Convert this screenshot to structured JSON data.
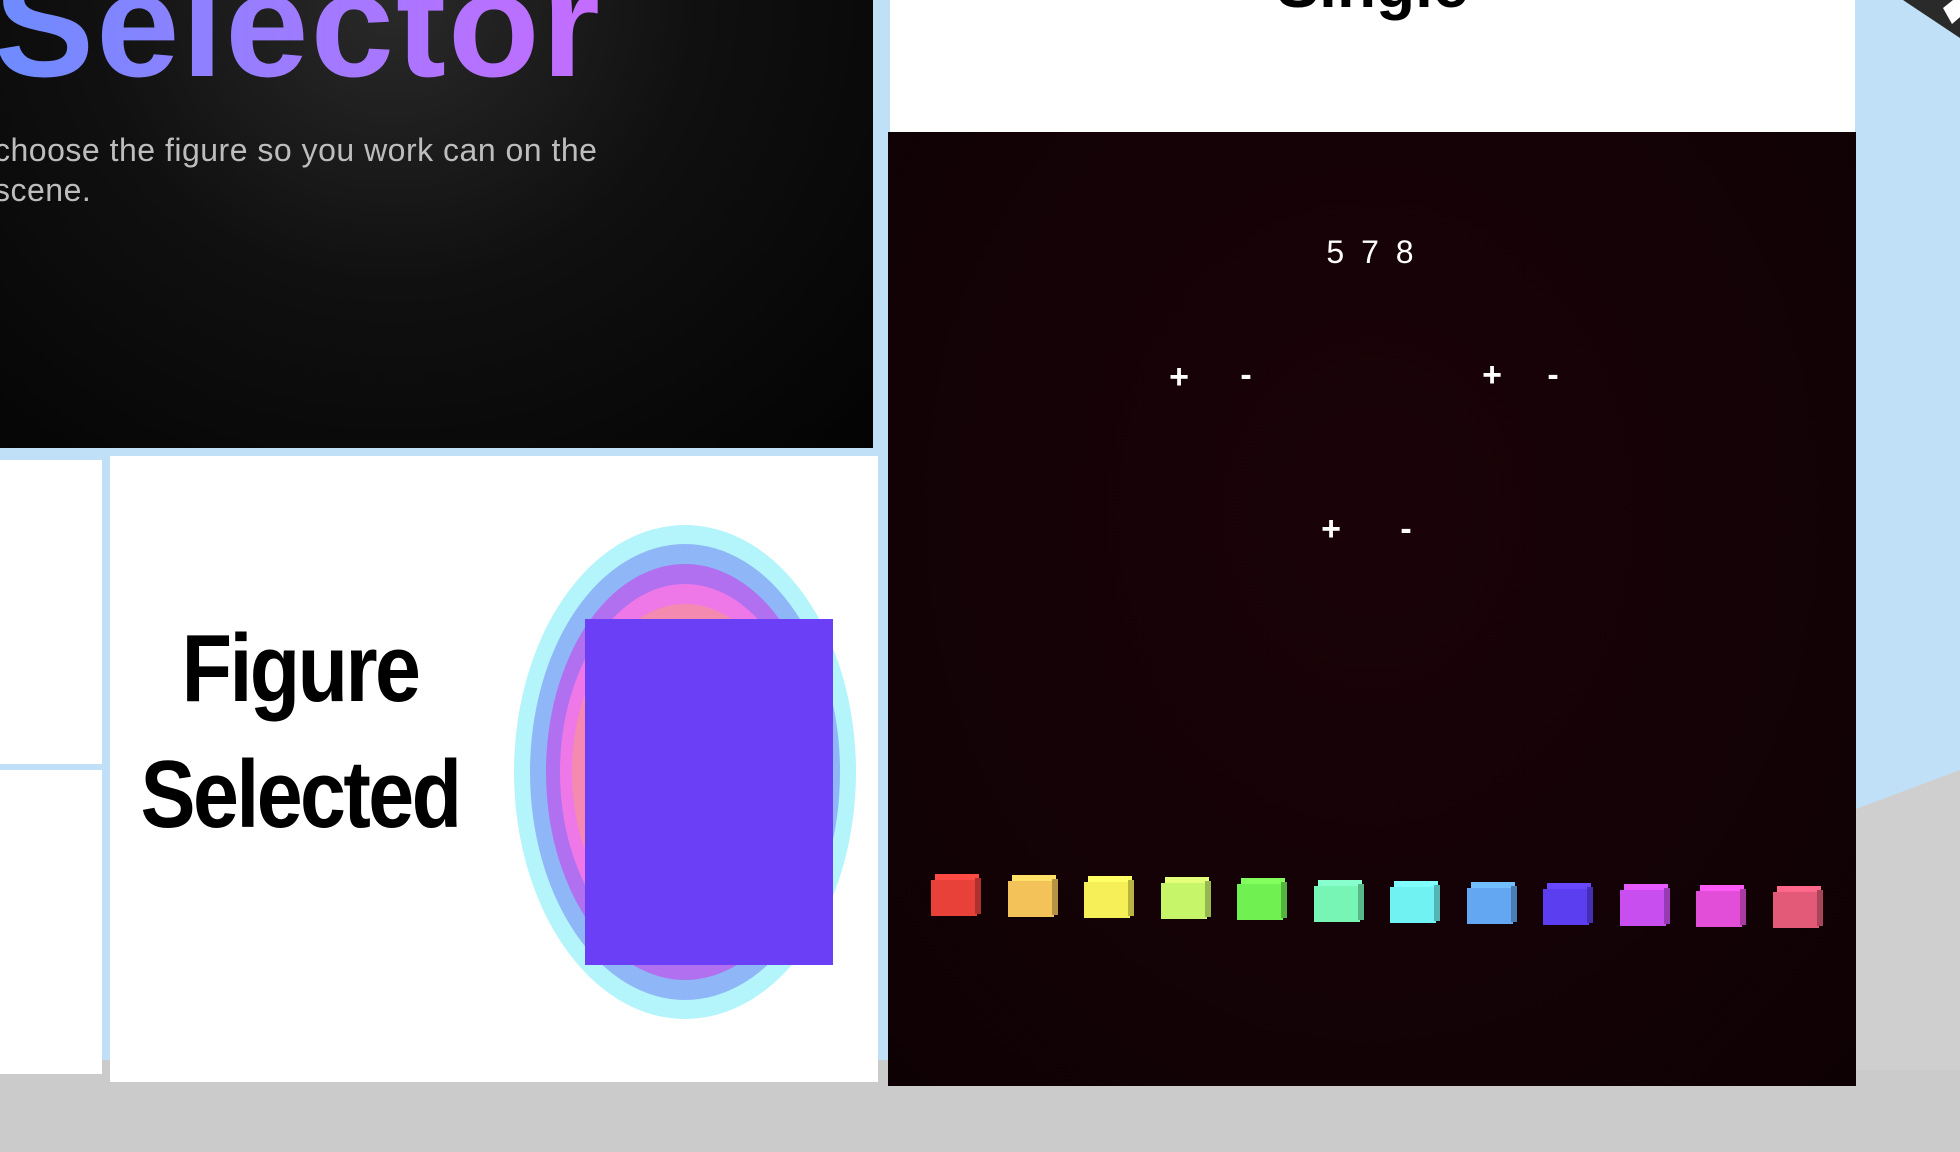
{
  "selector_panel": {
    "title": "Selector",
    "description": "choose the figure so you work can on the scene."
  },
  "figure_panel": {
    "label_line1": "Figure",
    "label_line2": "Selected",
    "selected_color": "#6b3ff5"
  },
  "single_panel": {
    "title": "Single"
  },
  "control_panel": {
    "counter": "5 7 8",
    "controls": [
      {
        "plus": "+",
        "minus": "-"
      },
      {
        "plus": "+",
        "minus": "-"
      },
      {
        "plus": "+",
        "minus": "-"
      }
    ],
    "palette": [
      "#e8413a",
      "#f3c35a",
      "#f7ef57",
      "#c6f56a",
      "#71f051",
      "#77f5b4",
      "#6ff2f1",
      "#63a6f2",
      "#5a3ef0",
      "#c84ef0",
      "#e24ed8",
      "#e35a78"
    ]
  }
}
